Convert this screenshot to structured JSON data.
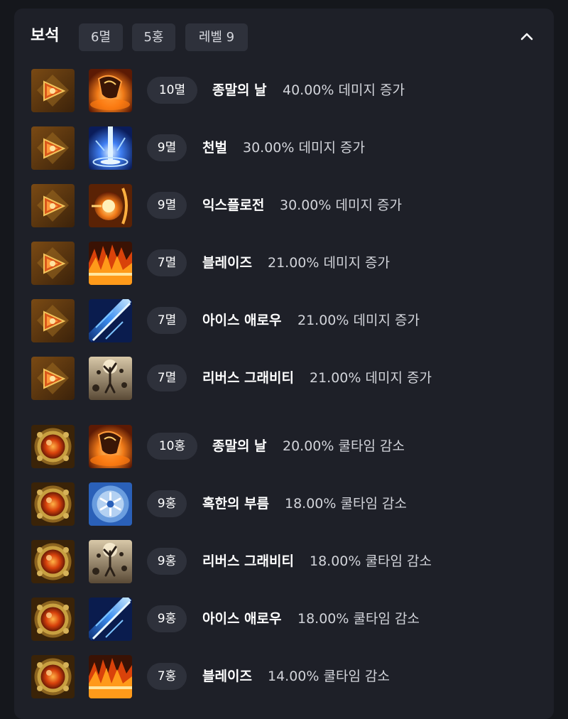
{
  "section": {
    "title": "보석",
    "tags": [
      "6멸",
      "5홍",
      "레벨 9"
    ]
  },
  "gems": [
    {
      "gem_icon": "doom-gem-icon",
      "skill_icon": "doomsday-skill-icon",
      "level": "10멸",
      "skill": "종말의 날",
      "effect": "40.00% 데미지 증가"
    },
    {
      "gem_icon": "doom-gem-icon",
      "skill_icon": "punishment-skill-icon",
      "level": "9멸",
      "skill": "천벌",
      "effect": "30.00% 데미지 증가"
    },
    {
      "gem_icon": "doom-gem-icon",
      "skill_icon": "explosion-skill-icon",
      "level": "9멸",
      "skill": "익스플로전",
      "effect": "30.00% 데미지 증가"
    },
    {
      "gem_icon": "doom-gem-icon",
      "skill_icon": "blaze-skill-icon",
      "level": "7멸",
      "skill": "블레이즈",
      "effect": "21.00% 데미지 증가"
    },
    {
      "gem_icon": "doom-gem-icon",
      "skill_icon": "ice-arrow-skill-icon",
      "level": "7멸",
      "skill": "아이스 애로우",
      "effect": "21.00% 데미지 증가"
    },
    {
      "gem_icon": "doom-gem-icon",
      "skill_icon": "reverse-gravity-skill-icon",
      "level": "7멸",
      "skill": "리버스 그래비티",
      "effect": "21.00% 데미지 증가"
    },
    {
      "gem_icon": "crimson-gem-icon",
      "skill_icon": "doomsday-skill-icon",
      "level": "10홍",
      "skill": "종말의 날",
      "effect": "20.00% 쿨타임 감소"
    },
    {
      "gem_icon": "crimson-gem-icon",
      "skill_icon": "frost-call-skill-icon",
      "level": "9홍",
      "skill": "혹한의 부름",
      "effect": "18.00% 쿨타임 감소"
    },
    {
      "gem_icon": "crimson-gem-icon",
      "skill_icon": "reverse-gravity-skill-icon",
      "level": "9홍",
      "skill": "리버스 그래비티",
      "effect": "18.00% 쿨타임 감소"
    },
    {
      "gem_icon": "crimson-gem-icon",
      "skill_icon": "ice-arrow-skill-icon",
      "level": "9홍",
      "skill": "아이스 애로우",
      "effect": "18.00% 쿨타임 감소"
    },
    {
      "gem_icon": "crimson-gem-icon",
      "skill_icon": "blaze-skill-icon",
      "level": "7홍",
      "skill": "블레이즈",
      "effect": "14.00% 쿨타임 감소"
    }
  ],
  "colors": {
    "background": "#15171c",
    "panel": "#1e2028",
    "pill": "#2e313b",
    "text": "#ffffff",
    "muted_text": "#d2d4da"
  }
}
